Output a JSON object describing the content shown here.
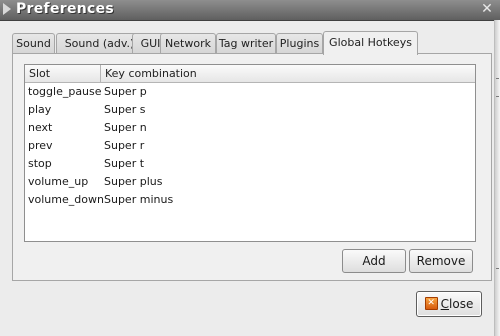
{
  "window": {
    "title": "Preferences",
    "close_glyph": "✕",
    "arrow_icon": "triangle-right-icon"
  },
  "tabs": [
    {
      "label": "Sound",
      "active": false
    },
    {
      "label": "Sound (adv.)",
      "active": false
    },
    {
      "label": "GUI",
      "active": false
    },
    {
      "label": "Network",
      "active": false
    },
    {
      "label": "Tag writer",
      "active": false
    },
    {
      "label": "Plugins",
      "active": false
    },
    {
      "label": "Global Hotkeys",
      "active": true
    }
  ],
  "hotkeys": {
    "columns": {
      "slot": "Slot",
      "key": "Key combination"
    },
    "rows": [
      {
        "slot": "toggle_pause",
        "key": "Super p"
      },
      {
        "slot": "play",
        "key": "Super s"
      },
      {
        "slot": "next",
        "key": "Super n"
      },
      {
        "slot": "prev",
        "key": "Super r"
      },
      {
        "slot": "stop",
        "key": "Super t"
      },
      {
        "slot": "volume_up",
        "key": "Super plus"
      },
      {
        "slot": "volume_down",
        "key": "Super minus"
      }
    ],
    "add_label": "Add",
    "remove_label": "Remove"
  },
  "footer": {
    "close_label_mnemonic": "C",
    "close_label_rest": "lose",
    "close_icon": "close-icon",
    "close_icon_glyph": "✕"
  },
  "colors": {
    "titlebar": "#5f5f5f",
    "close_icon": "#e07018"
  }
}
